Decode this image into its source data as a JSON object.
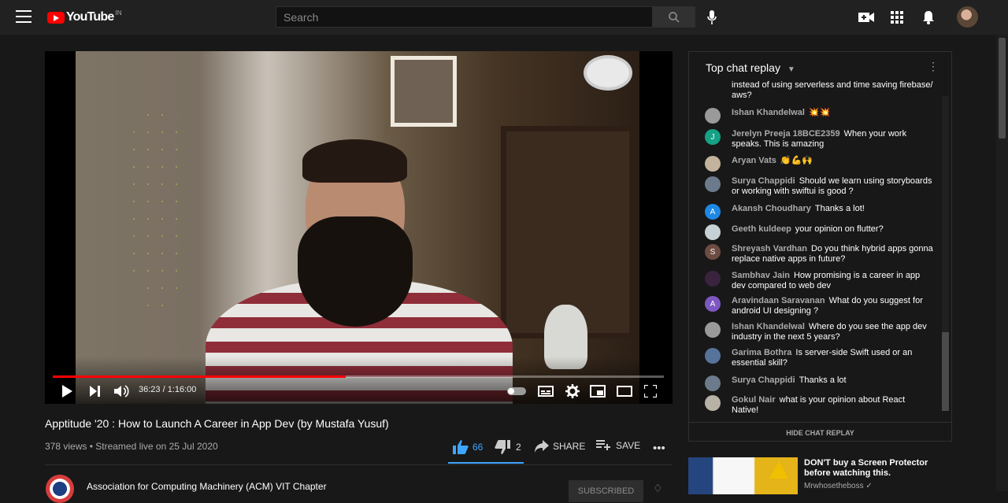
{
  "header": {
    "logo_text": "YouTube",
    "region": "IN",
    "search_placeholder": "Search",
    "icons": [
      "menu-icon",
      "search-icon",
      "microphone-icon",
      "create-video-icon",
      "apps-grid-icon",
      "notifications-bell-icon",
      "user-avatar"
    ]
  },
  "player": {
    "time": "36:23 / 1:16:00",
    "progress": 0.48,
    "controls": [
      "play-icon",
      "next-icon",
      "volume-icon",
      "autoplay-toggle",
      "captions-icon",
      "settings-gear-icon",
      "miniplayer-icon",
      "theater-mode-icon",
      "fullscreen-icon"
    ]
  },
  "video": {
    "title": "Apptitude '20 : How to Launch A Career in App Dev (by Mustafa Yusuf)",
    "meta": "378 views • Streamed live on 25 Jul 2020",
    "likes": "66",
    "dislikes": "2",
    "share": "SHARE",
    "save": "SAVE"
  },
  "channel": {
    "name": "Association for Computing Machinery (ACM) VIT Chapter",
    "subscribe": "SUBSCRIBED"
  },
  "chat": {
    "title": "Top chat replay",
    "hide_label": "HIDE CHAT REPLAY",
    "messages": [
      {
        "author": "",
        "text": "instead of using serverless and time saving firebase/ aws?",
        "initial": "",
        "color": "#181818"
      },
      {
        "author": "Ishan Khandelwal",
        "text": "💥💥",
        "initial": "",
        "color": "#9a9a9a"
      },
      {
        "author": "Jerelyn Preeja 18BCE2359",
        "text": "When your work speaks. This is amazing",
        "initial": "J",
        "color": "#16a085"
      },
      {
        "author": "Aryan Vats",
        "text": "👏💪🙌",
        "initial": "",
        "color": "#c3b39c"
      },
      {
        "author": "Surya Chappidi",
        "text": "Should we learn using storyboards or working with swiftui is good ?",
        "initial": "",
        "color": "#6b7b8c"
      },
      {
        "author": "Akansh Choudhary",
        "text": "Thanks a lot!",
        "initial": "A",
        "color": "#1e88e5"
      },
      {
        "author": "Geeth kuldeep",
        "text": "your opinion on flutter?",
        "initial": "",
        "color": "#c5d1d4"
      },
      {
        "author": "Shreyash Vardhan",
        "text": "Do you think hybrid apps gonna replace native apps in future?",
        "initial": "S",
        "color": "#6d4c41"
      },
      {
        "author": "Sambhav Jain",
        "text": "How promising is a career in app dev compared to web dev",
        "initial": "",
        "color": "#3a233f"
      },
      {
        "author": "Aravindaan Saravanan",
        "text": "What do you suggest for android UI designing ?",
        "initial": "A",
        "color": "#7e57c2"
      },
      {
        "author": "Ishan Khandelwal",
        "text": "Where do you see the app dev industry in the next 5 years?",
        "initial": "",
        "color": "#9a9a9a"
      },
      {
        "author": "Garima Bothra",
        "text": "Is server-side Swift used or an essential skill?",
        "initial": "",
        "color": "#56739a"
      },
      {
        "author": "Surya Chappidi",
        "text": "Thanks a lot",
        "initial": "",
        "color": "#6b7b8c"
      },
      {
        "author": "Gokul Nair",
        "text": "what is your opinion about React Native!",
        "initial": "",
        "color": "#b8b1a6"
      }
    ]
  },
  "recommendation": {
    "title": "DON'T buy a Screen Protector before watching this.",
    "channel": "Mrwhosetheboss ✓"
  }
}
